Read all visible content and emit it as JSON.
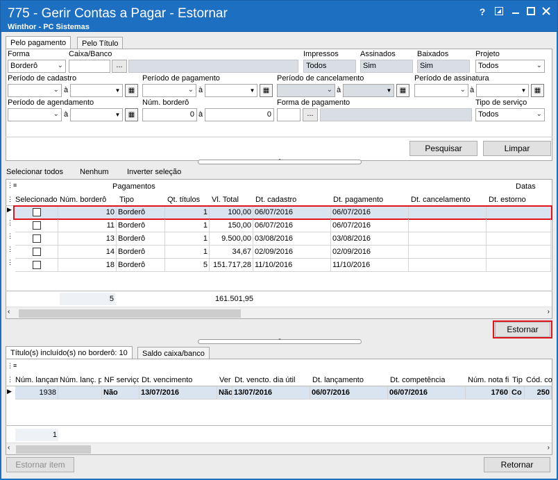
{
  "window": {
    "title": "775 - Gerir Contas a Pagar - Estornar",
    "subtitle": "Winthor - PC Sistemas",
    "help_icon": "?",
    "colors": {
      "titlebar": "#1d6fc1",
      "selected_row": "#d9e4f0",
      "highlight": "#e0121b"
    }
  },
  "tabs": [
    "Pelo pagamento",
    "Pelo Título"
  ],
  "filters": {
    "forma": {
      "label": "Forma",
      "value": "Borderô"
    },
    "caixa_banco": {
      "label": "Caixa/Banco",
      "value": "",
      "button": "..."
    },
    "impressos": {
      "label": "Impressos",
      "value": "Todos"
    },
    "assinados": {
      "label": "Assinados",
      "value": "Sim"
    },
    "baixados": {
      "label": "Baixados",
      "value": "Sim"
    },
    "projeto": {
      "label": "Projeto",
      "value": "Todos"
    },
    "periodo_cadastro": {
      "label": "Período de cadastro",
      "sep": "à"
    },
    "periodo_pagamento": {
      "label": "Período de pagamento",
      "sep": "à"
    },
    "periodo_cancelamento": {
      "label": "Período de cancelamento",
      "sep": "à"
    },
    "periodo_assinatura": {
      "label": "Período de assinatura",
      "sep": "à"
    },
    "periodo_agendamento": {
      "label": "Período de agendamento",
      "sep": "à"
    },
    "num_bordero": {
      "label": "Núm. borderô",
      "from": "0",
      "sep": "à",
      "to": "0"
    },
    "forma_pagamento": {
      "label": "Forma de pagamento",
      "button": "..."
    },
    "tipo_servico": {
      "label": "Tipo de serviço",
      "value": "Todos"
    }
  },
  "actions": {
    "pesquisar": "Pesquisar",
    "limpar": "Limpar",
    "estornar": "Estornar",
    "estornar_item": "Estornar item",
    "retornar": "Retornar"
  },
  "selection": {
    "select_all": "Selecionar todos",
    "none": "Nenhum",
    "invert": "Inverter seleção"
  },
  "grid1": {
    "group_pagamentos": "Pagamentos",
    "group_datas": "Datas",
    "columns": [
      "Selecionado",
      "Núm. borderô",
      "Tipo",
      "Qt. títulos",
      "Vl. Total",
      "Dt. cadastro",
      "Dt. pagamento",
      "Dt. cancelamento",
      "Dt. estorno"
    ],
    "rows": [
      {
        "num": "10",
        "tipo": "Borderô",
        "qt": "1",
        "vl": "100,00",
        "cad": "06/07/2016",
        "pag": "06/07/2016",
        "selected": false
      },
      {
        "num": "11",
        "tipo": "Borderô",
        "qt": "1",
        "vl": "150,00",
        "cad": "06/07/2016",
        "pag": "06/07/2016",
        "selected": false
      },
      {
        "num": "13",
        "tipo": "Borderô",
        "qt": "1",
        "vl": "9.500,00",
        "cad": "03/08/2016",
        "pag": "03/08/2016",
        "selected": false
      },
      {
        "num": "14",
        "tipo": "Borderô",
        "qt": "1",
        "vl": "34,67",
        "cad": "02/09/2016",
        "pag": "02/09/2016",
        "selected": false
      },
      {
        "num": "18",
        "tipo": "Borderô",
        "qt": "5",
        "vl": "151.717,28",
        "cad": "11/10/2016",
        "pag": "11/10/2016",
        "selected": false
      }
    ],
    "footer": {
      "count": "5",
      "total": "161.501,95"
    }
  },
  "bottom_tabs": [
    "Título(s) incluído(s) no borderô: 10",
    "Saldo caixa/banco"
  ],
  "grid2": {
    "columns": [
      "Núm. lançam",
      "Núm. lanç. p",
      "NF serviço",
      "Dt. vencimento",
      "Ver",
      "Dt. vencto. dia útil",
      "Dt. lançamento",
      "Dt. competência",
      "Núm. nota fi",
      "Tip",
      "Cód. co"
    ],
    "row": {
      "num": "1938",
      "nf": "Não",
      "venc": "13/07/2016",
      "ver": "Não",
      "venc_util": "13/07/2016",
      "lanc": "06/07/2016",
      "comp": "06/07/2016",
      "nota": "1760",
      "tip": "Co",
      "cod": "250"
    },
    "footer": {
      "count": "1"
    }
  }
}
